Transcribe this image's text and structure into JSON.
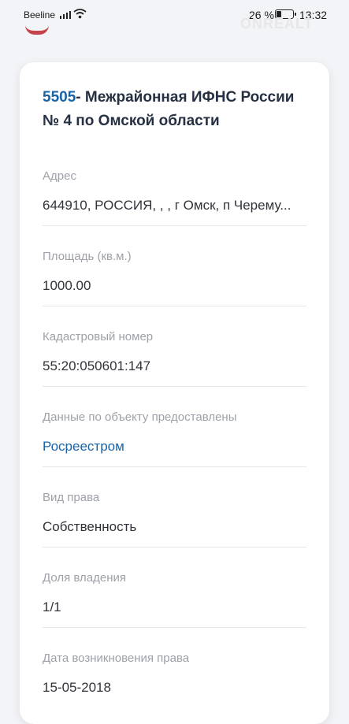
{
  "status": {
    "carrier": "Beeline",
    "battery": "26 %",
    "time": "13:32"
  },
  "title": {
    "code": "5505",
    "name": "- Межрайонная ИФНС России № 4 по Омской области"
  },
  "fields": [
    {
      "label": "Адрес",
      "value": "644910, РОССИЯ, , , г Омск, п Черему..."
    },
    {
      "label": "Площадь (кв.м.)",
      "value": "1000.00"
    },
    {
      "label": "Кадастровый номер",
      "value": "55:20:050601:147"
    },
    {
      "label": "Данные по объекту предоставлены",
      "value": "Росреестром"
    },
    {
      "label": "Вид права",
      "value": "Собственность"
    },
    {
      "label": "Доля владения",
      "value": "1/1"
    },
    {
      "label": "Дата возникновения права",
      "value": "15-05-2018"
    }
  ],
  "colors": {
    "accent": "#1764a8",
    "brand_red": "#c0262d"
  },
  "icons": [
    "signal-icon",
    "wifi-icon",
    "battery-icon",
    "logo-icon"
  ]
}
